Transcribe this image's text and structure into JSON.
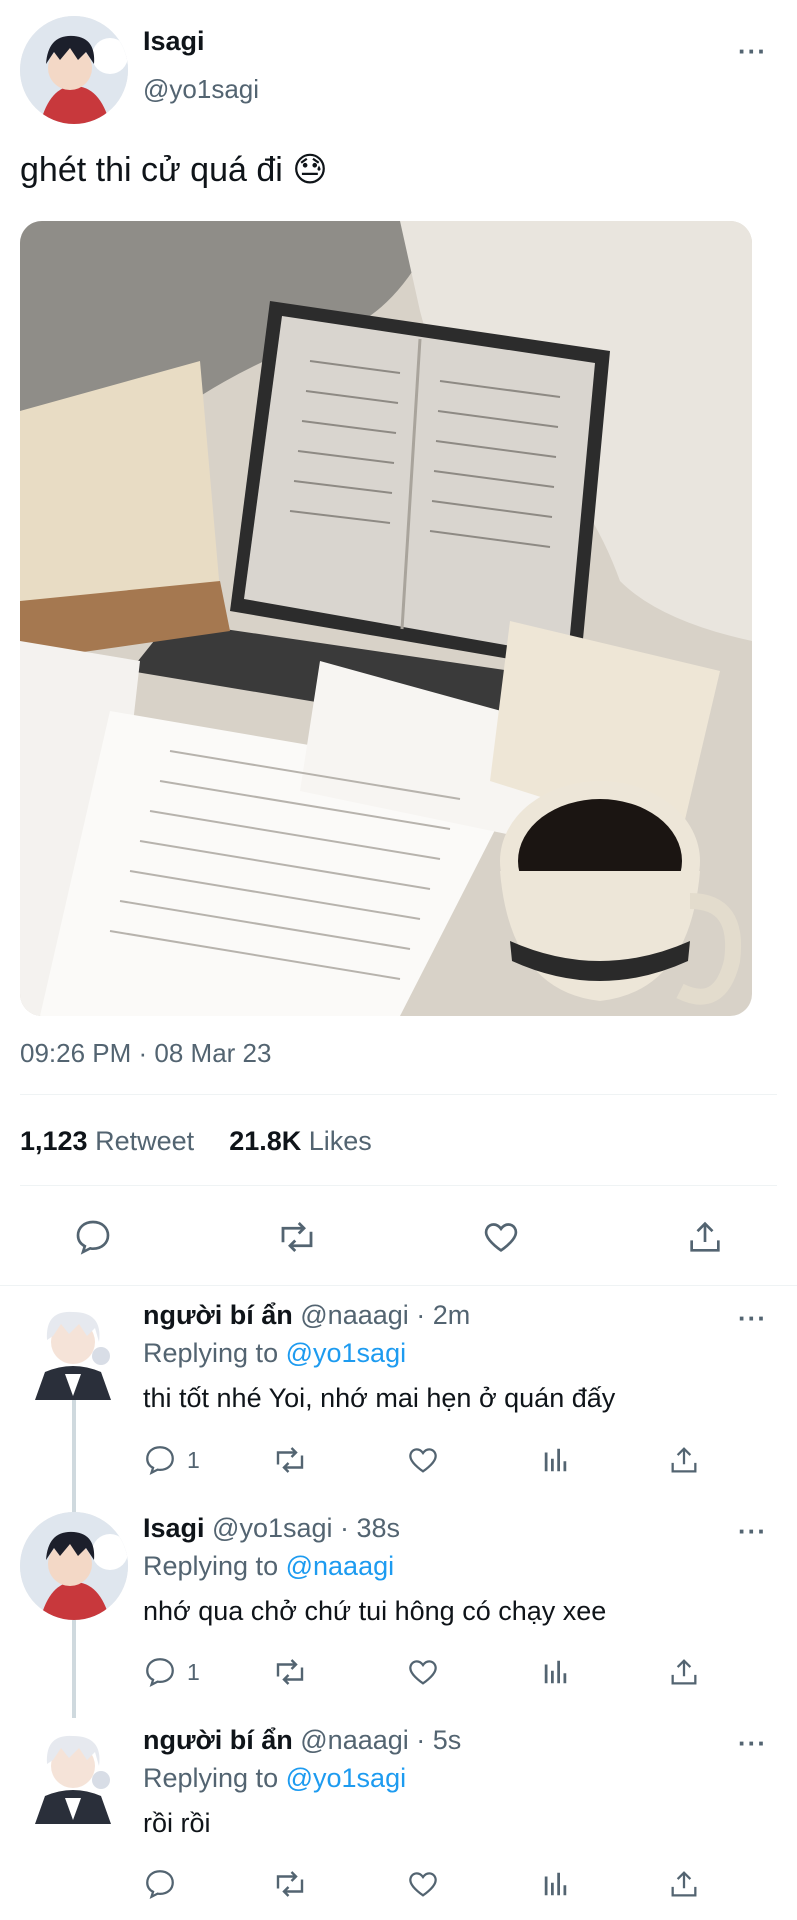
{
  "tweet": {
    "author_name": "Isagi",
    "author_handle": "@yo1sagi",
    "text": "ghét thi cử quá đi 😓",
    "image_icon": "photo-laptop-books-coffee",
    "timestamp": "09:26 PM · 08 Mar 23",
    "retweets_count": "1,123",
    "retweets_label": "Retweet",
    "likes_count": "21.8K",
    "likes_label": "Likes",
    "more_icon": "more-icon"
  },
  "replies": [
    {
      "author_name": "người bí ẩn",
      "handle_time": "@naaagi · 2m",
      "replying_label": "Replying to",
      "replying_to": "@yo1sagi",
      "text": "thi tốt nhé Yoi, nhớ mai hẹn ở quán đấy",
      "reply_count": "1"
    },
    {
      "author_name": "Isagi",
      "handle_time": "@yo1sagi · 38s",
      "replying_label": "Replying to",
      "replying_to": "@naaagi",
      "text": "nhớ qua chở chứ tui hông có chạy xee",
      "reply_count": "1"
    },
    {
      "author_name": "người bí ẩn",
      "handle_time": "@naaagi · 5s",
      "replying_label": "Replying to",
      "replying_to": "@yo1sagi",
      "text": "rồi rồi",
      "reply_count": ""
    }
  ],
  "colors": {
    "accent": "#1d9bf0",
    "secondary_text": "#536471",
    "divider": "#eff3f4"
  }
}
